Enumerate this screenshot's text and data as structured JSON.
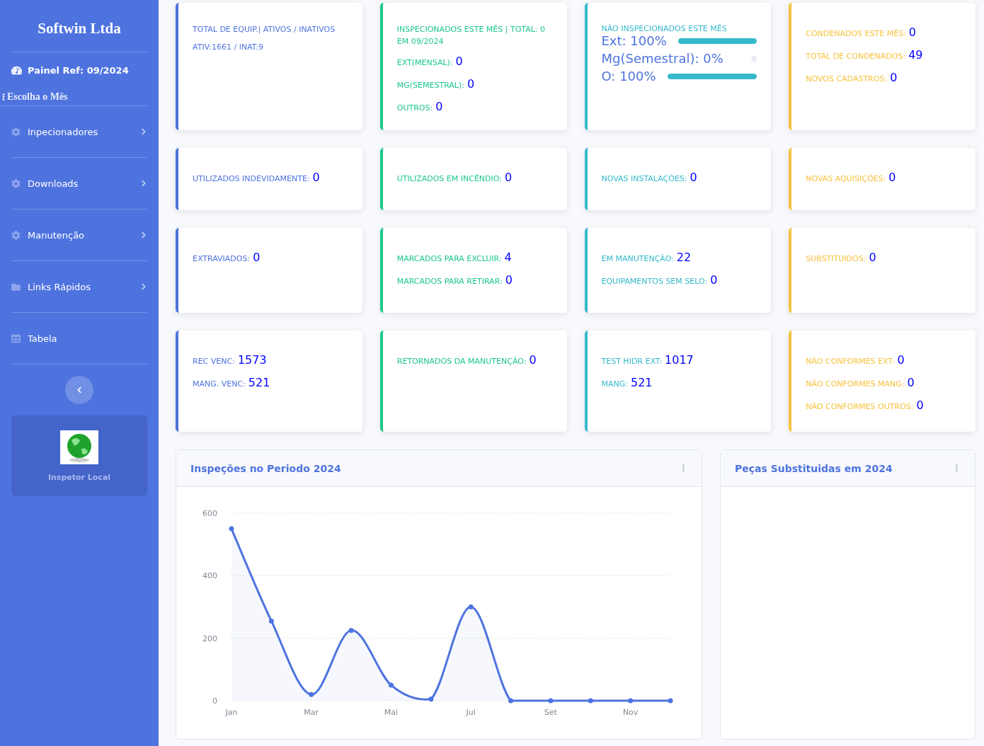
{
  "sidebar": {
    "brand": "Softwin Ltda",
    "panel_ref": "Painel Ref: 09/2024",
    "month_picker": "Escolha o Mês",
    "items": [
      {
        "label": "Inpecionadores",
        "kind": "settings",
        "expanded": false
      },
      {
        "label": "Downloads",
        "kind": "settings",
        "expanded": false
      },
      {
        "label": "Manutenção",
        "kind": "settings",
        "expanded": false
      },
      {
        "label": "Links Rápidos",
        "kind": "folder",
        "expanded": false
      },
      {
        "label": "Tabela",
        "kind": "table"
      }
    ],
    "user_card": {
      "name": "Inspetor Local"
    }
  },
  "card_rows": [
    {
      "cards": [
        {
          "kind": "stats",
          "color": "#4e73df",
          "lines": [
            {
              "label": "TOTAL DE EQUIP.| ATIVOS / INATIVOS"
            },
            {
              "label": "ATIV:1661 / INAT:9"
            }
          ]
        },
        {
          "kind": "stats",
          "color": "#1cc88a",
          "lines": [
            {
              "label": "INSPECIONADOS ESTE MÊS | TOTAL: 0 EM 09/2024"
            },
            {
              "label": "EXT(MENSAL):",
              "value": "0"
            },
            {
              "label": "MG(SEMESTRAL):",
              "value": "0"
            },
            {
              "label": "OUTROS:",
              "value": "0"
            }
          ]
        },
        {
          "kind": "progress",
          "color": "#36b9cc",
          "title": "NÃO INSPECIONADOS ESTE MÊS",
          "bars": [
            {
              "label": "Ext: 100%",
              "level": 1
            },
            {
              "label": "Mg(Semestral): 0%",
              "level": 0
            },
            {
              "label": "O: 100%",
              "level": 1
            }
          ]
        },
        {
          "kind": "stats",
          "color": "#f6c23e",
          "lines": [
            {
              "label": "CONDENADOS ESTE MÊS:",
              "value": "0"
            },
            {
              "label": "TOTAL DE CONDENADOS:",
              "value": "49"
            },
            {
              "label": "NOVOS CADASTROS:",
              "value": "0"
            }
          ]
        }
      ]
    },
    {
      "cards": [
        {
          "kind": "stats",
          "color": "#4e73df",
          "lines": [
            {
              "label": "UTILIZADOS INDEVIDAMENTE:",
              "value": "0"
            }
          ]
        },
        {
          "kind": "stats",
          "color": "#1cc88a",
          "lines": [
            {
              "label": "UTILIZADOS EM INCÊNDIO:",
              "value": "0"
            }
          ]
        },
        {
          "kind": "stats",
          "color": "#36b9cc",
          "lines": [
            {
              "label": "NOVAS INSTALAÇÕES:",
              "value": "0"
            }
          ]
        },
        {
          "kind": "stats",
          "color": "#f6c23e",
          "lines": [
            {
              "label": "NOVAS AQUISIÇÕES:",
              "value": "0"
            }
          ]
        }
      ]
    },
    {
      "cards": [
        {
          "kind": "stats",
          "color": "#4e73df",
          "lines": [
            {
              "label": "EXTRAVIADOS:",
              "value": "0"
            }
          ]
        },
        {
          "kind": "stats",
          "color": "#1cc88a",
          "lines": [
            {
              "label": "MARCADOS PARA EXCLUIR:",
              "value": "4"
            },
            {
              "label": "MARCADOS PARA RETIRAR:",
              "value": "0"
            }
          ]
        },
        {
          "kind": "stats",
          "color": "#36b9cc",
          "lines": [
            {
              "label": "EM MANUTENÇÃO:",
              "value": "22"
            },
            {
              "label": "EQUIPAMENTOS SEM SELO:",
              "value": "0"
            }
          ]
        },
        {
          "kind": "stats",
          "color": "#f6c23e",
          "lines": [
            {
              "label": "SUBSTITUIDOS:",
              "value": "0"
            }
          ]
        }
      ]
    },
    {
      "cards": [
        {
          "kind": "stats",
          "color": "#4e73df",
          "lines": [
            {
              "label": "REC VENC:",
              "value": "1573"
            },
            {
              "label": "MANG. VENC:",
              "value": "521"
            }
          ]
        },
        {
          "kind": "stats",
          "color": "#1cc88a",
          "lines": [
            {
              "label": "RETORNADOS DA MANUTENÇÃO:",
              "value": "0"
            }
          ]
        },
        {
          "kind": "stats",
          "color": "#36b9cc",
          "lines": [
            {
              "label": "TEST HIDR EXT:",
              "value": "1017"
            },
            {
              "label": "MANG:",
              "value": "521"
            }
          ]
        },
        {
          "kind": "stats",
          "color": "#f6c23e",
          "lines": [
            {
              "label": "NÃO CONFORMES EXT:",
              "value": "0"
            },
            {
              "label": "NÃO CONFORMES MANG:",
              "value": "0"
            },
            {
              "label": "NÃO CONFORMES OUTROS:",
              "value": "0"
            }
          ]
        }
      ]
    }
  ],
  "panels": [
    {
      "title": "Inspeções no Periodo 2024",
      "chart_data": {
        "type": "line",
        "categories": [
          "Jan",
          null,
          "Mar",
          null,
          "Mai",
          null,
          "Jul",
          null,
          "Set",
          null,
          "Nov",
          null
        ],
        "series": [
          {
            "color": "#4e73df",
            "marker": "circle",
            "values": [
              550,
              255,
              20,
              225,
              50,
              5,
              300,
              0,
              0,
              0,
              0,
              0
            ]
          }
        ],
        "ylim": [
          0,
          600
        ],
        "yticks": [
          0,
          200,
          400,
          600
        ]
      }
    },
    {
      "title": "Peças Substituidas em 2024"
    }
  ]
}
